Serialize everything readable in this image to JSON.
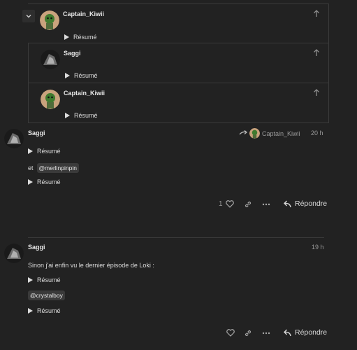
{
  "embedded_replies": [
    {
      "name": "Captain_Kiwii",
      "avatar": "kiwi",
      "summary": "Résumé"
    },
    {
      "name": "Saggi",
      "avatar": "saggi",
      "summary": "Résumé"
    },
    {
      "name": "Captain_Kiwii",
      "avatar": "kiwi",
      "summary": "Résumé"
    }
  ],
  "post1": {
    "author": "Saggi",
    "reply_to": "Captain_Kiwii",
    "time": "20 h",
    "summary1": "Résumé",
    "and": "et",
    "mention": "@merlinpinpin",
    "summary2": "Résumé",
    "like_count": "1",
    "reply_label": "Répondre"
  },
  "post2": {
    "author": "Saggi",
    "time": "19 h",
    "text": "Sinon j'ai enfin vu le dernier épisode de Loki :",
    "summary1": "Résumé",
    "mention": "@crystalboy",
    "summary2": "Résumé",
    "reply_label": "Répondre"
  },
  "colors": {
    "background": "#222222",
    "text": "#dddddd",
    "muted": "#9a9a9a",
    "border": "#3a3a3a"
  },
  "icons": [
    "chevron-down-icon",
    "arrow-up-icon",
    "reply-arrow-icon",
    "heart-icon",
    "link-icon",
    "ellipsis-icon"
  ]
}
